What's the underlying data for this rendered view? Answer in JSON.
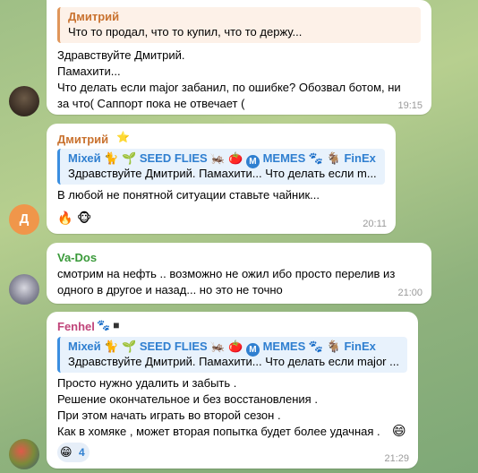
{
  "messages": [
    {
      "reply": {
        "name": "Дмитрий",
        "text": "Что то продал, что то купил, что то держу..."
      },
      "lines": [
        "Здравствуйте Дмитрий.",
        "Памахити...",
        "Что делать если major забанил, по ошибке? Обозвал ботом, ни",
        "за что( Саппорт пока не отвечает ("
      ],
      "time": "19:15"
    },
    {
      "sender": "Дмитрий",
      "sender_badge": "⭐",
      "reply": {
        "name_parts": [
          "Міхей",
          "🐈",
          "🌱",
          "SEED FLIES",
          "🦗",
          "🍅",
          "M",
          "MEMES",
          "🐾",
          "🐐",
          "FinEx"
        ],
        "text": "Здравствуйте Дмитрий. Памахити... Что делать если m..."
      },
      "lines": [
        "В любой не понятной ситуации ставьте чайник..."
      ],
      "reactions": [
        "🔥",
        "🐵"
      ],
      "avatar_letter": "Д",
      "time": "20:11"
    },
    {
      "sender": "Va-Dos",
      "lines": [
        "смотрим на нефть ..  возможно не ожил  ибо просто перелив из",
        "одного в другое и назад... но это не точно"
      ],
      "time": "21:00"
    },
    {
      "sender": "Fenhel",
      "sender_badge": "🐾 ■",
      "reply": {
        "name_parts": [
          "Міхей",
          "🐈",
          "🌱",
          "SEED FLIES",
          "🦗",
          "🍅",
          "M",
          "MEMES",
          "🐾",
          "🐐",
          "FinEx"
        ],
        "text": "Здравствуйте Дмитрий. Памахити... Что делать если major ..."
      },
      "lines": [
        "Просто нужно удалить и забыть .",
        "Решение окончательное и без восстановления .",
        "При этом начать играть во второй сезон .",
        "Как в хомяке , может вторая попытка будет более удачная ."
      ],
      "last_emoji": "😄",
      "reaction": {
        "emoji": "😁",
        "count": "4"
      },
      "time": "21:29"
    }
  ],
  "colors": {
    "accent": "#3a8ee0",
    "dmitry": "#c9722f",
    "vados": "#3a9a3a",
    "fenhel": "#c0457a"
  }
}
